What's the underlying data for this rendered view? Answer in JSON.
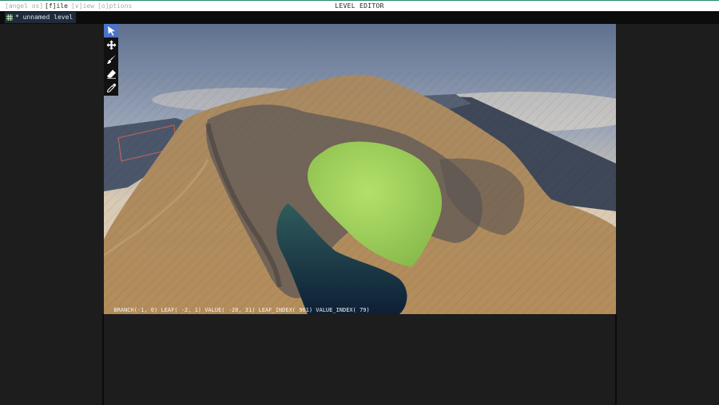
{
  "menubar": {
    "items": [
      {
        "label": "[angel os]",
        "dim": true
      },
      {
        "label": "[f]ile",
        "dim": false
      },
      {
        "label": "[v]iew",
        "dim": true
      },
      {
        "label": "[o]ptions",
        "dim": true
      }
    ],
    "title": "LEVEL EDITOR"
  },
  "tab": {
    "label": "* unnamed level",
    "icon": "grid-icon"
  },
  "toolbar": {
    "tools": [
      {
        "name": "select-tool",
        "icon": "cursor-arrow-icon",
        "active": true
      },
      {
        "name": "move-tool",
        "icon": "move-arrows-icon",
        "active": false
      },
      {
        "name": "paint-tool",
        "icon": "brush-icon",
        "active": false
      },
      {
        "name": "erase-tool",
        "icon": "eraser-icon",
        "active": false
      },
      {
        "name": "picker-tool",
        "icon": "eyedropper-icon",
        "active": false
      }
    ]
  },
  "viewport": {
    "status": "  BRANCH(-1, 0) LEAF( -2, 1) VALUE( -28, 31) LEAF_INDEX( 961) VALUE_INDEX( 79)"
  },
  "colors": {
    "accent": "#4b74c8",
    "tab_bg": "#1f2a3a",
    "panel_bg": "#1d1d1d",
    "terrain_sand": "#b9915e",
    "grass": "#9fd15c",
    "water": "#1f3550"
  }
}
